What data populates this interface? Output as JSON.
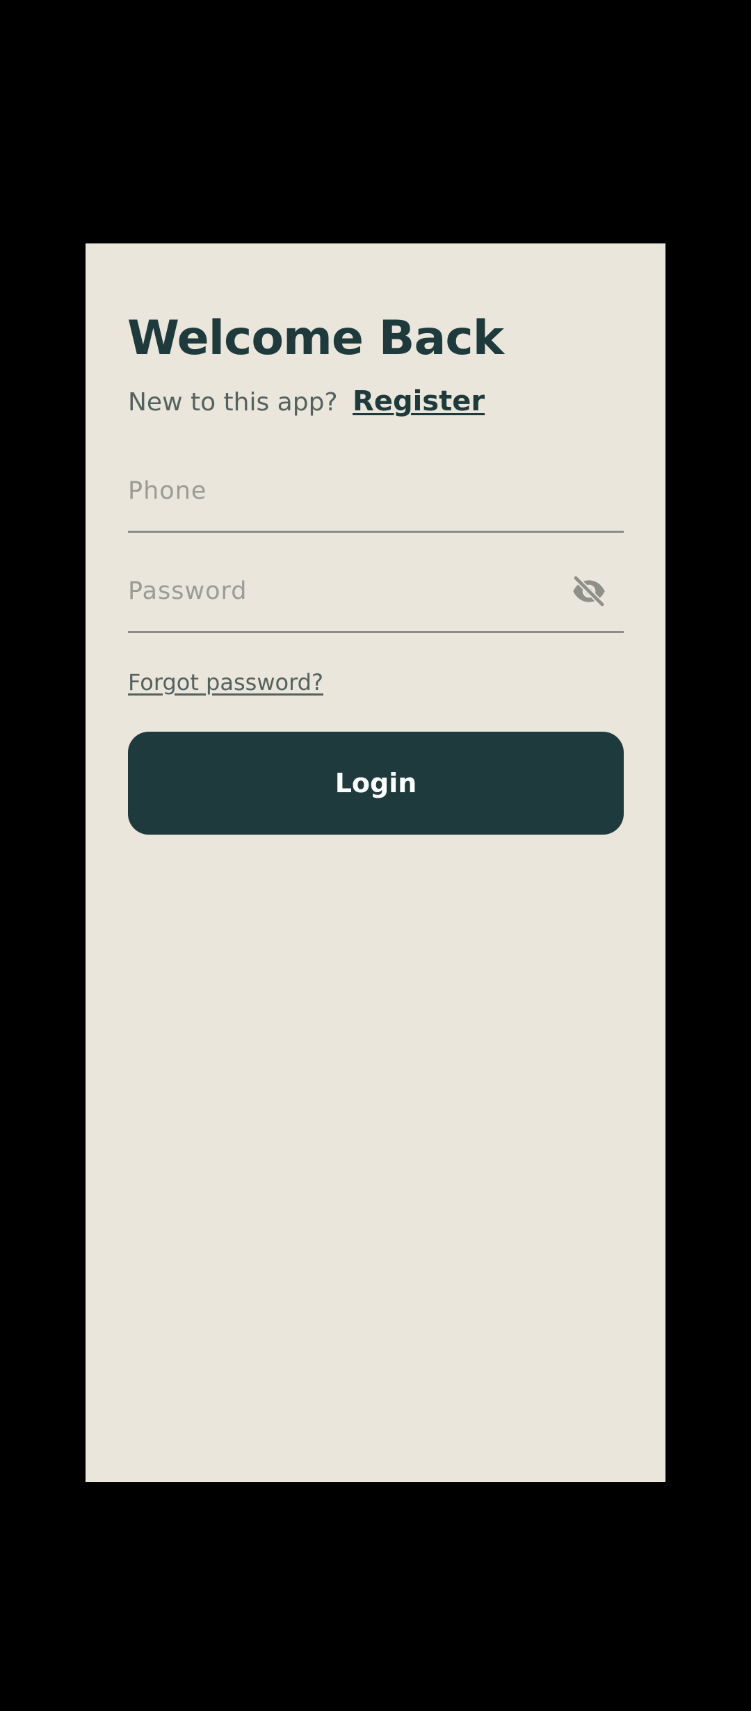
{
  "header": {
    "title": "Welcome Back",
    "prompt_text": "New to this app?",
    "register_label": "Register"
  },
  "form": {
    "phone": {
      "value": "",
      "placeholder": "Phone"
    },
    "password": {
      "value": "",
      "placeholder": "Password",
      "toggle_icon": "eye-off-icon"
    },
    "forgot_password_label": "Forgot password?",
    "login_label": "Login"
  },
  "colors": {
    "background": "#EAE6DB",
    "primary": "#1E3A3C",
    "muted_text": "#54625F",
    "placeholder": "#9B9C95",
    "divider": "#8C8E86",
    "outer_frame": "#000000"
  }
}
